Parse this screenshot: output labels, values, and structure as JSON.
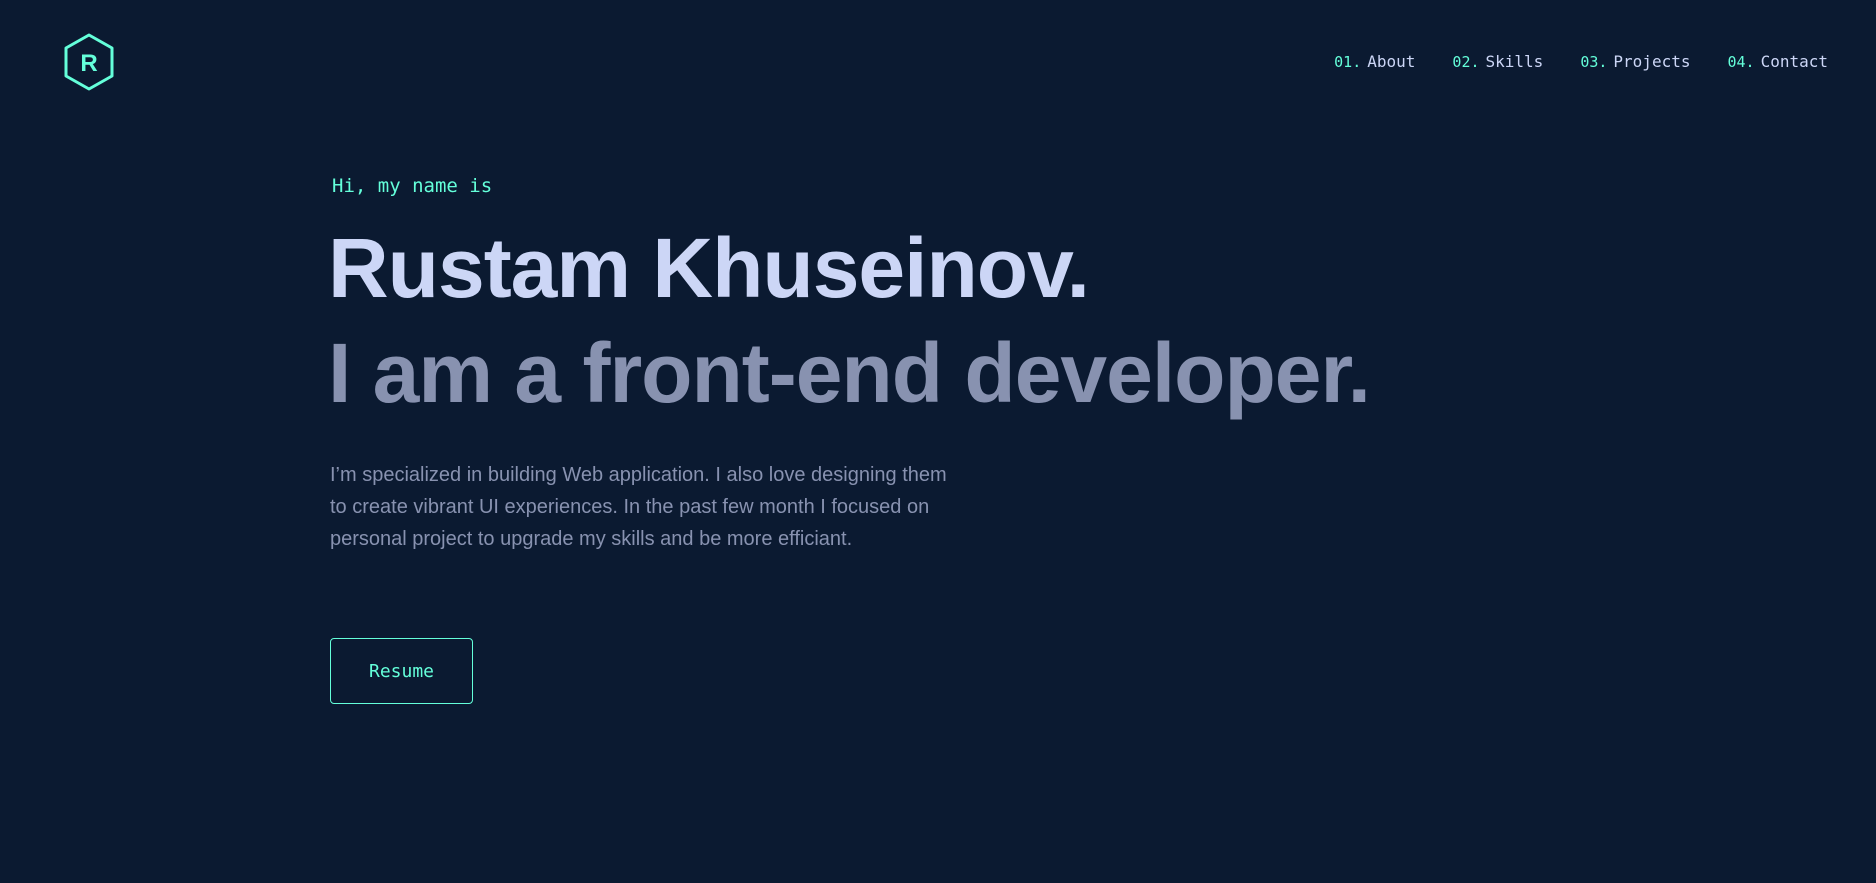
{
  "logo": {
    "letter": "R",
    "icon": "hexagon-logo-icon",
    "accent_color": "#64ffda"
  },
  "nav": {
    "items": [
      {
        "number": "01.",
        "label": "About"
      },
      {
        "number": "02.",
        "label": "Skills"
      },
      {
        "number": "03.",
        "label": "Projects"
      },
      {
        "number": "04.",
        "label": "Contact"
      }
    ]
  },
  "hero": {
    "greeting": "Hi, my name is",
    "name": "Rustam Khuseinov.",
    "tagline": "I am a front-end developer.",
    "bio": "I’m specialized in building Web application. I also love designing them to create vibrant UI experiences. In the past few month I focused on personal project to upgrade my skills and be more efficiant.",
    "resume_label": "Resume"
  },
  "colors": {
    "background": "#0b1a31",
    "accent": "#64ffda",
    "heading": "#ccd6f6",
    "muted": "#8892b0"
  }
}
